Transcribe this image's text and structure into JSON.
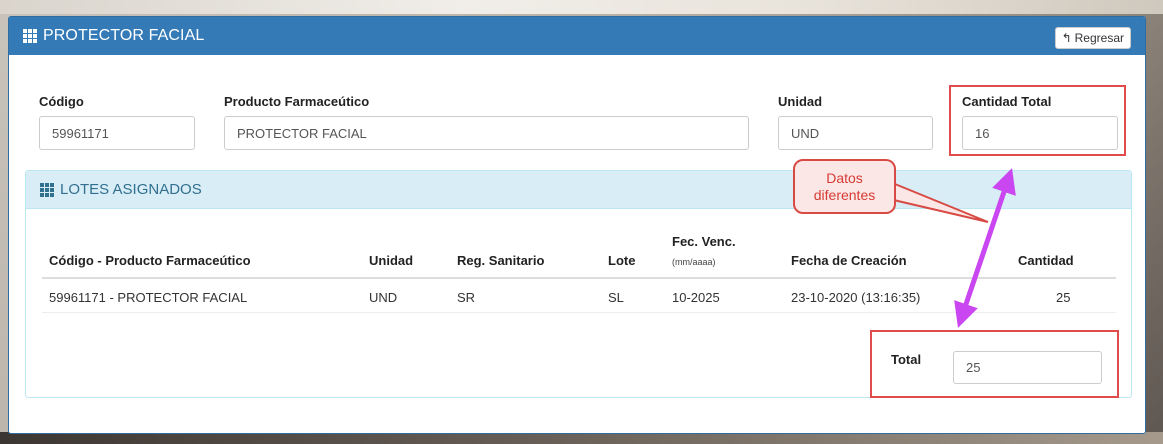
{
  "panel": {
    "title": "PROTECTOR FACIAL",
    "back_button": "Regresar"
  },
  "form": {
    "codigo": {
      "label": "Código",
      "value": "59961171"
    },
    "producto": {
      "label": "Producto Farmaceútico",
      "value": "PROTECTOR FACIAL"
    },
    "unidad": {
      "label": "Unidad",
      "value": "UND"
    },
    "cantidad_total": {
      "label": "Cantidad Total",
      "value": "16"
    }
  },
  "lotes": {
    "title": "LOTES ASIGNADOS",
    "columns": {
      "producto": "Código - Producto Farmaceútico",
      "unidad": "Unidad",
      "reg_sanitario": "Reg. Sanitario",
      "lote": "Lote",
      "fec_venc": "Fec. Venc.",
      "fec_venc_format": "(mm/aaaa)",
      "fecha_creacion": "Fecha de Creación",
      "cantidad": "Cantidad"
    },
    "rows": [
      {
        "producto": "59961171 - PROTECTOR FACIAL",
        "unidad": "UND",
        "reg_sanitario": "SR",
        "lote": "SL",
        "fec_venc": "10-2025",
        "fecha_creacion": "23-10-2020 (13:16:35)",
        "cantidad": "25"
      }
    ],
    "total_label": "Total",
    "total_value": "25"
  },
  "annotation": {
    "line1": "Datos",
    "line2": "diferentes",
    "box_color": "#e04b4b",
    "arrow_color": "#c946f0"
  },
  "colors": {
    "header": "#337ab7",
    "sub_header": "#d9edf7",
    "sub_header_text": "#31708f"
  }
}
